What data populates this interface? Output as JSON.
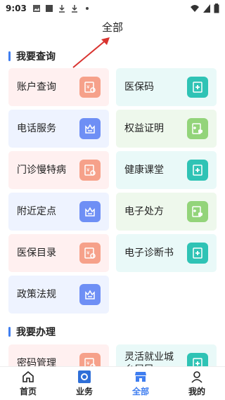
{
  "status_bar": {
    "time": "9:03"
  },
  "header": {
    "title": "全部"
  },
  "sections": [
    {
      "title": "我要查询",
      "items": [
        {
          "label": "账户查询",
          "icon": "account-doc-icon"
        },
        {
          "label": "医保码",
          "icon": "medical-plus-icon"
        },
        {
          "label": "电话服务",
          "icon": "crown-building-icon"
        },
        {
          "label": "权益证明",
          "icon": "certificate-shield-icon"
        },
        {
          "label": "门诊慢特病",
          "icon": "account-doc-icon"
        },
        {
          "label": "健康课堂",
          "icon": "medical-plus-icon"
        },
        {
          "label": "附近定点",
          "icon": "crown-building-icon"
        },
        {
          "label": "电子处方",
          "icon": "certificate-shield-icon"
        },
        {
          "label": "医保目录",
          "icon": "account-doc-icon"
        },
        {
          "label": "电子诊断书",
          "icon": "medical-plus-icon"
        },
        {
          "label": "政策法规",
          "icon": "crown-building-icon"
        }
      ]
    },
    {
      "title": "我要办理",
      "items": [
        {
          "label": "密码管理",
          "icon": "account-doc-icon"
        },
        {
          "label": "灵活就业城乡居民",
          "icon": "medical-plus-icon"
        }
      ]
    }
  ],
  "tabbar": {
    "tabs": [
      {
        "label": "首页",
        "icon": "home-icon"
      },
      {
        "label": "业务",
        "icon": "business-app-icon"
      },
      {
        "label": "全部",
        "icon": "all-shop-icon"
      },
      {
        "label": "我的",
        "icon": "user-icon"
      }
    ],
    "active": "全部"
  },
  "colors": {
    "accent": "#3f7ef0",
    "pink_icon": "#f6a18a",
    "blue_icon": "#6e8ff5",
    "cyan_icon": "#2fc3b5",
    "green_icon": "#93d47a"
  }
}
